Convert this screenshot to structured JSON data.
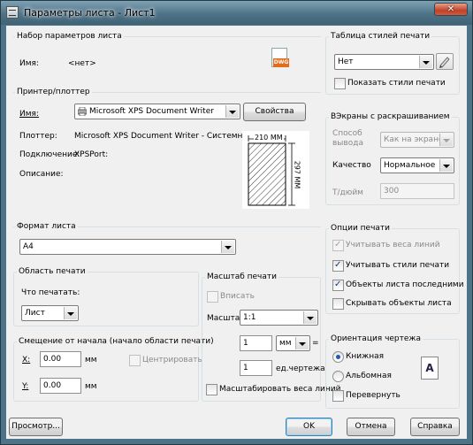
{
  "window": {
    "title": "Параметры листа - Лист1"
  },
  "page_setup": {
    "group_label": "Набор параметров листа",
    "name_label": "Имя:",
    "name_value": "<нет>",
    "dwg_badge": "DWG"
  },
  "printer": {
    "group_label": "Принтер/плоттер",
    "name_label": "Имя:",
    "name_value": "Microsoft XPS Document Writer",
    "properties_button": "Свойства",
    "plotter_label": "Плоттер:",
    "plotter_value": "Microsoft XPS Document Writer - Системный дра...",
    "connection_label": "Подключение:",
    "connection_value": "XPSPort:",
    "description_label": "Описание:",
    "paper_width": "210 ММ",
    "paper_height": "297 ММ"
  },
  "paper_size": {
    "group_label": "Формат листа",
    "value": "A4"
  },
  "plot_area": {
    "group_label": "Область печати",
    "what_label": "Что печатать:",
    "what_value": "Лист"
  },
  "plot_offset": {
    "group_label": "Смещение от начала (начало области печати)",
    "x_label": "X:",
    "x_value": "0.00",
    "x_unit": "мм",
    "y_label": "Y:",
    "y_value": "0.00",
    "y_unit": "мм",
    "center_label": "Центрировать"
  },
  "plot_scale": {
    "group_label": "Масштаб печати",
    "fit_label": "Вписать",
    "scale_label": "Масштаб:",
    "scale_value": "1:1",
    "value1": "1",
    "unit_value": "мм",
    "equals": "=",
    "value2": "1",
    "unit_label": "ед.чертежа",
    "lineweights_label": "Масштабировать веса линий"
  },
  "plot_style_table": {
    "group_label": "Таблица стилей печати",
    "value": "Нет",
    "display_label": "Показать стили печати"
  },
  "shaded": {
    "group_label": "ВЭкраны с раскрашиванием",
    "shade_label": "Способ вывода",
    "shade_value": "Как на экране",
    "quality_label": "Качество",
    "quality_value": "Нормальное",
    "dpi_label": "Т/дюйм",
    "dpi_value": "300"
  },
  "plot_options": {
    "group_label": "Опции печати",
    "opt1": "Учитывать веса линий",
    "opt2": "Учитывать стили печати",
    "opt3": "Объекты листа последними",
    "opt4": "Скрывать объекты листа"
  },
  "orientation": {
    "group_label": "Ориентация чертежа",
    "portrait": "Книжная",
    "landscape": "Альбомная",
    "upside_down": "Перевернуть",
    "icon_letter": "A"
  },
  "buttons": {
    "preview": "Просмотр...",
    "ok": "OK",
    "cancel": "Отмена",
    "help": "Справка"
  }
}
